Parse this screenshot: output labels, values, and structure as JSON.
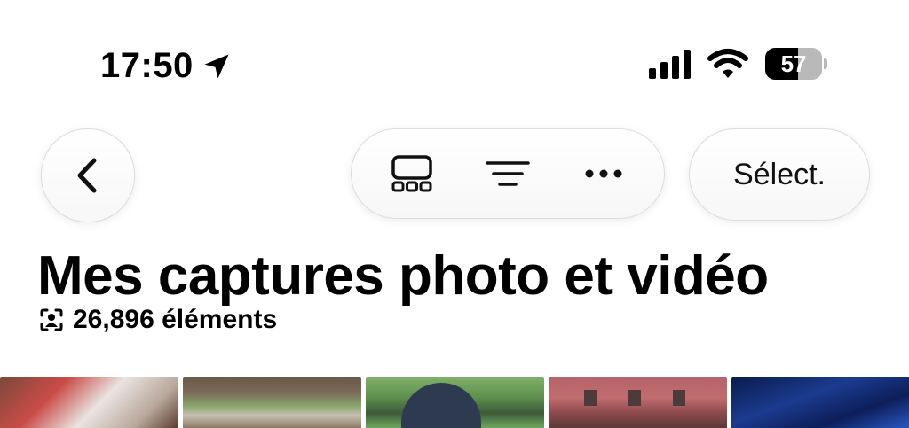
{
  "status_bar": {
    "time": "17:50",
    "battery_level": "57",
    "battery_fraction": 0.57
  },
  "toolbar": {
    "back_icon": "chevron-left-icon",
    "layout_icon": "grid-layout-icon",
    "filter_icon": "filter-lines-icon",
    "more_icon": "ellipsis-icon",
    "select_label": "Sélect."
  },
  "header": {
    "title": "Mes captures photo et vidéo",
    "count_text": "26,896 éléments",
    "count_icon": "person-viewfinder-icon"
  },
  "thumbnails": [
    {
      "name": "photo-1"
    },
    {
      "name": "photo-2"
    },
    {
      "name": "photo-3"
    },
    {
      "name": "photo-4"
    },
    {
      "name": "photo-5"
    }
  ],
  "colors": {
    "background": "#ffffff",
    "text": "#000000",
    "button_border": "#dcdcdc"
  }
}
